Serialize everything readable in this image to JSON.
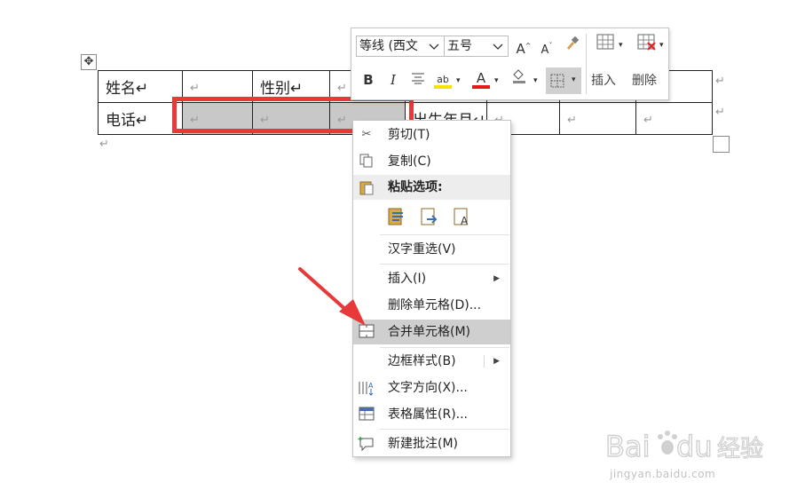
{
  "table": {
    "rows": [
      [
        "姓名↵",
        "↵",
        "性别↵",
        "↵",
        "",
        "",
        "",
        "",
        ""
      ],
      [
        "电话↵",
        "↵",
        "↵",
        "↵",
        "出生年月↵",
        "↵",
        "↵",
        "↵",
        ""
      ]
    ],
    "paragraph_mark": "↵"
  },
  "mini_toolbar": {
    "font_name": "等线 (西文",
    "font_size": "五号",
    "grow_font": "A",
    "shrink_font": "A",
    "bold": "B",
    "italic": "I",
    "highlight_label": "ab",
    "font_color_label": "A",
    "insert_label": "插入",
    "delete_label": "删除",
    "colors": {
      "highlight": "#f5e400",
      "font_color": "#e31b1b"
    }
  },
  "context_menu": {
    "items": [
      {
        "label": "剪切(T)",
        "icon": "scissors-icon"
      },
      {
        "label": "复制(C)",
        "icon": "copy-icon"
      },
      {
        "label": "粘贴选项:",
        "icon": "paste-icon"
      },
      {
        "label": "汉字重选(V)",
        "icon": ""
      },
      {
        "label": "插入(I)",
        "icon": "",
        "submenu": true
      },
      {
        "label": "删除单元格(D)...",
        "icon": ""
      },
      {
        "label": "合并单元格(M)",
        "icon": "merge-cells-icon",
        "highlighted": true
      },
      {
        "label": "边框样式(B)",
        "icon": "",
        "submenu": true
      },
      {
        "label": "文字方向(X)...",
        "icon": "text-direction-icon"
      },
      {
        "label": "表格属性(R)...",
        "icon": "table-properties-icon"
      },
      {
        "label": "新建批注(M)",
        "icon": "new-comment-icon"
      }
    ]
  },
  "watermark": {
    "logo": "Baidu经验",
    "url": "jingyan.baidu.com"
  },
  "colors": {
    "selection_box": "#e8393a",
    "arrow": "#e8393a",
    "selected_cell": "#c8c8c8",
    "menu_highlight": "#cfcfcf"
  }
}
